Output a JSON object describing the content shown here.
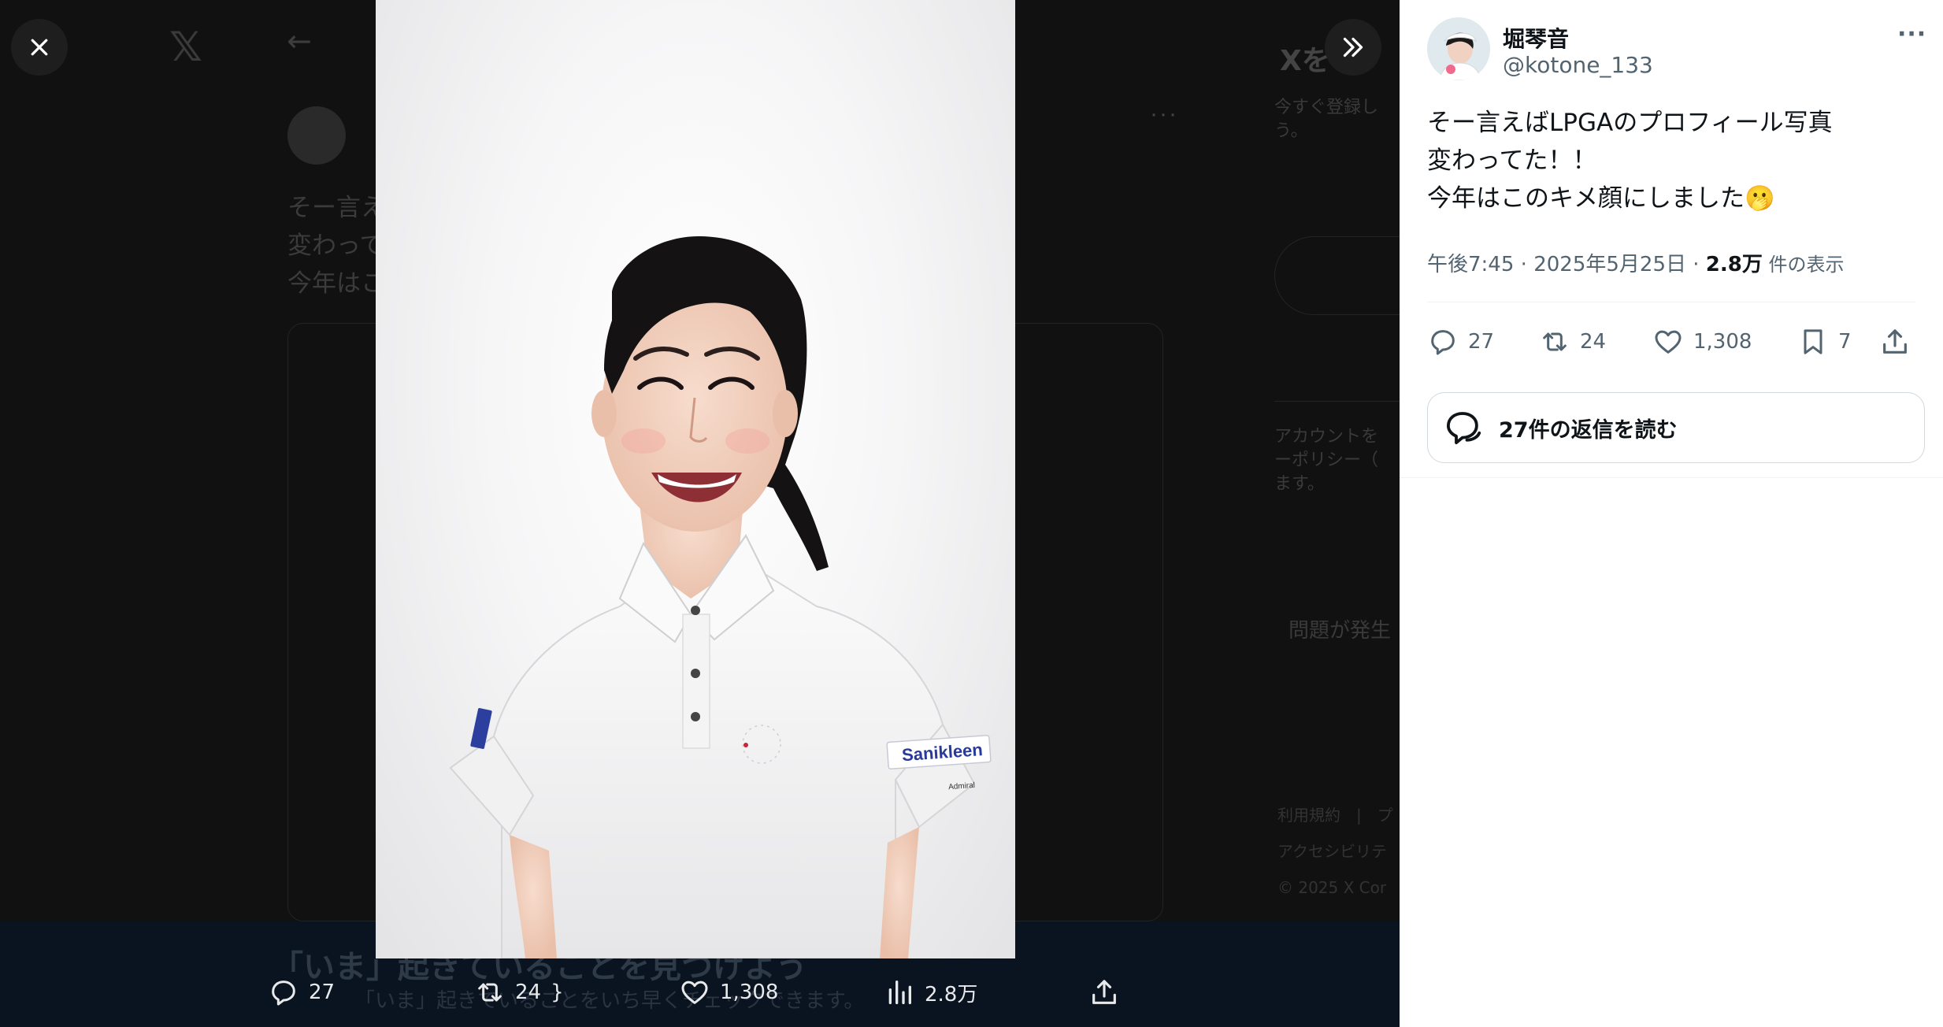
{
  "viewer": {
    "close_label": "×",
    "background": {
      "logo": "𝕏",
      "back_arrow": "←",
      "tweet_lines": [
        "そー言え",
        "変わって",
        "今年はこ"
      ],
      "side_title": "Xを",
      "side_text": [
        "今すぐ登録し",
        "う。"
      ],
      "side_legal": [
        "アカウントを",
        "ーポリシー（",
        "ます。"
      ],
      "side_error": "問題が発生",
      "side_footer": [
        "利用規約　|　プ",
        "アクセシビリテ",
        "© 2025 X Cor"
      ],
      "banner_title": "「いま」起きていることを見つけよう",
      "banner_sub": "「いま」起きていることをいち早くチェックできます。"
    },
    "media_actions": {
      "replies": "27",
      "reposts": "24",
      "likes": "1,308",
      "views": "2.8万"
    },
    "shirt_brand": "Sanikleen",
    "shirt_sub": "Admiral"
  },
  "tweet": {
    "author_name": "堀琴音",
    "author_handle": "@kotone_133",
    "more_label": "···",
    "text_lines": [
      "そー言えばLPGAのプロフィール写真",
      "変わってた！！",
      "今年はこのキメ顔にしました"
    ],
    "emoji": "🫢",
    "time": "午後7:45",
    "sep": " · ",
    "date": "2025年5月25日",
    "views_count": "2.8万",
    "views_label": " 件の表示",
    "stats": {
      "replies": "27",
      "reposts": "24",
      "likes": "1,308",
      "bookmarks": "7"
    },
    "read_replies_label": "27件の返信を読む"
  },
  "colors": {
    "text_primary": "#0f1419",
    "text_secondary": "#536471",
    "border": "#cfd9de",
    "overlay_bg": "#0f0f0f"
  },
  "icons": [
    "close-icon",
    "expand-icon",
    "reply-icon",
    "repost-icon",
    "like-icon",
    "bookmark-icon",
    "views-icon",
    "share-icon",
    "more-icon",
    "replies-bubble-icon"
  ]
}
